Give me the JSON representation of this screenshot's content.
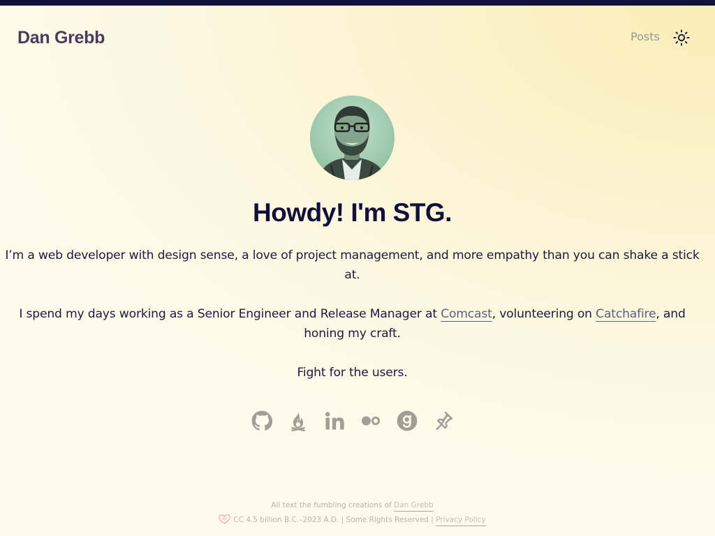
{
  "site": {
    "title": "Dan Grebb",
    "nav": [
      {
        "label": "Posts"
      }
    ],
    "theme_toggle_icon": "sun-icon"
  },
  "hero": {
    "avatar_icon": "avatar-photo",
    "headline": "Howdy! I'm STG.",
    "intro": "I’m a web developer with design sense, a love of project management, and more empathy than you can shake a stick at.",
    "work": {
      "before": "I spend my days working as a Senior Engineer and Release Manager at ",
      "link1": "Comcast",
      "middle": ", volunteering on ",
      "link2": "Catchafire",
      "after": ", and honing my craft."
    },
    "motto": "Fight for the users."
  },
  "socials": [
    {
      "name": "github-icon"
    },
    {
      "name": "campfire-icon"
    },
    {
      "name": "linkedin-icon"
    },
    {
      "name": "flickr-icon"
    },
    {
      "name": "goodreads-icon"
    },
    {
      "name": "pinboard-icon"
    }
  ],
  "footer": {
    "line1_text": "All text the fumbling creations of ",
    "line1_link": "Dan Grebb",
    "license_icon": "creative-commons-heart-icon",
    "line2_text": "CC 4.5 billion B.C.–2023 A.D. | Some Rights Reserved | ",
    "line2_link": "Privacy Policy"
  },
  "colors": {
    "topbar": "#11103a",
    "headline": "#11103a",
    "title": "#4a3b5c",
    "nav": "#9a9694",
    "icons": "#a19e98",
    "background_gradient": [
      "#faedb6",
      "#fefbec"
    ]
  }
}
